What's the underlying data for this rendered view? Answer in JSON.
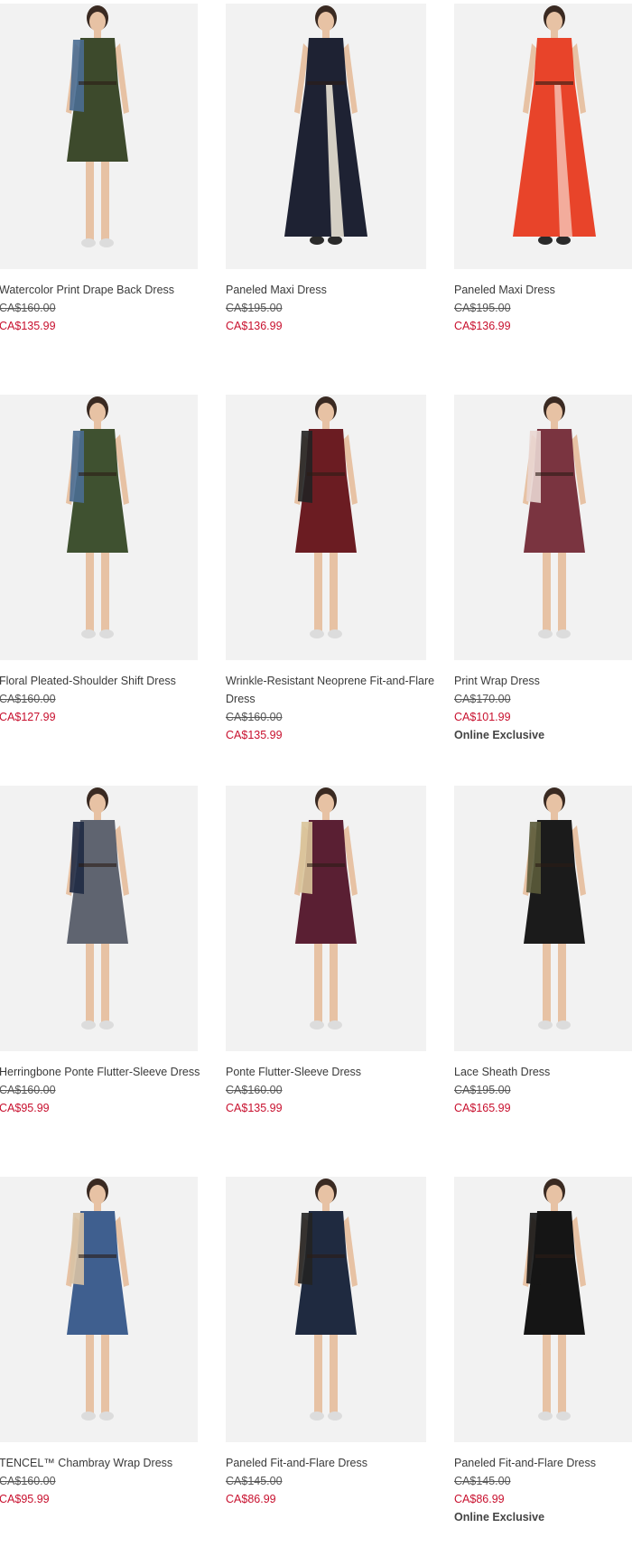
{
  "products": [
    {
      "name": "Watercolor Print Drape Back Dress",
      "original_price": "CA$160.00",
      "sale_price": "CA$135.99",
      "badge": "",
      "dress_color": "#3d4a2c",
      "accent_color": "#4a6d92"
    },
    {
      "name": "Paneled Maxi Dress",
      "original_price": "CA$195.00",
      "sale_price": "CA$136.99",
      "badge": "",
      "dress_color": "#1e2233",
      "accent_color": "#e8e2d4"
    },
    {
      "name": "Paneled Maxi Dress",
      "original_price": "CA$195.00",
      "sale_price": "CA$136.99",
      "badge": "",
      "dress_color": "#e8442a",
      "accent_color": "#f4b8a8"
    },
    {
      "name": "Floral Pleated-Shoulder Shift Dress",
      "original_price": "CA$160.00",
      "sale_price": "CA$127.99",
      "badge": "",
      "dress_color": "#3f5130",
      "accent_color": "#4a6d92"
    },
    {
      "name": "Wrinkle-Resistant Neoprene Fit-and-Flare Dress",
      "original_price": "CA$160.00",
      "sale_price": "CA$135.99",
      "badge": "",
      "dress_color": "#6b1c22",
      "accent_color": "#222222"
    },
    {
      "name": "Print Wrap Dress",
      "original_price": "CA$170.00",
      "sale_price": "CA$101.99",
      "badge": "Online Exclusive",
      "dress_color": "#7a3440",
      "accent_color": "#e9d6d2"
    },
    {
      "name": "Herringbone Ponte Flutter-Sleeve Dress",
      "original_price": "CA$160.00",
      "sale_price": "CA$95.99",
      "badge": "",
      "dress_color": "#5f6470",
      "accent_color": "#1f2a44"
    },
    {
      "name": "Ponte Flutter-Sleeve Dress",
      "original_price": "CA$160.00",
      "sale_price": "CA$135.99",
      "badge": "",
      "dress_color": "#5a1f33",
      "accent_color": "#d9c49a"
    },
    {
      "name": "Lace Sheath Dress",
      "original_price": "CA$195.00",
      "sale_price": "CA$165.99",
      "badge": "",
      "dress_color": "#1b1b1b",
      "accent_color": "#5b5b3a"
    },
    {
      "name": "TENCEL™ Chambray Wrap Dress",
      "original_price": "CA$160.00",
      "sale_price": "CA$95.99",
      "badge": "",
      "dress_color": "#3f5f8f",
      "accent_color": "#d8c2a4"
    },
    {
      "name": "Paneled Fit-and-Flare Dress",
      "original_price": "CA$145.00",
      "sale_price": "CA$86.99",
      "badge": "",
      "dress_color": "#1f2a40",
      "accent_color": "#222222"
    },
    {
      "name": "Paneled Fit-and-Flare Dress",
      "original_price": "CA$145.00",
      "sale_price": "CA$86.99",
      "badge": "Online Exclusive",
      "dress_color": "#151515",
      "accent_color": "#151515"
    }
  ],
  "colors": {
    "sale": "#c8102e",
    "text": "#3a3a3a",
    "photo_bg": "#f2f2f2"
  }
}
